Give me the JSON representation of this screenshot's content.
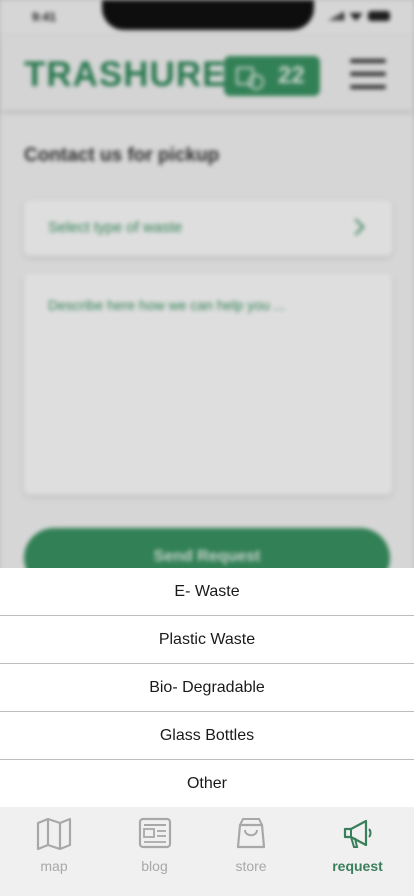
{
  "status_bar": {
    "time": "9:41"
  },
  "header": {
    "logo": "TRASHURE",
    "points": "22"
  },
  "page": {
    "title": "Contact us for pickup",
    "select_placeholder": "Select type of waste",
    "description_placeholder": "Describe here how we can help you ...",
    "send_button": "Send Request"
  },
  "waste_options": [
    "E- Waste",
    "Plastic Waste",
    "Bio- Degradable",
    "Glass Bottles",
    "Other"
  ],
  "bottom_nav": {
    "items": [
      {
        "label": "map",
        "icon": "map-icon"
      },
      {
        "label": "blog",
        "icon": "blog-icon"
      },
      {
        "label": "store",
        "icon": "bag-icon"
      },
      {
        "label": "request",
        "icon": "megaphone-icon",
        "active": true
      }
    ]
  },
  "colors": {
    "accent": "#3a9463",
    "active_nav": "#3a7f5c",
    "inactive_nav": "#a8a8a8"
  }
}
